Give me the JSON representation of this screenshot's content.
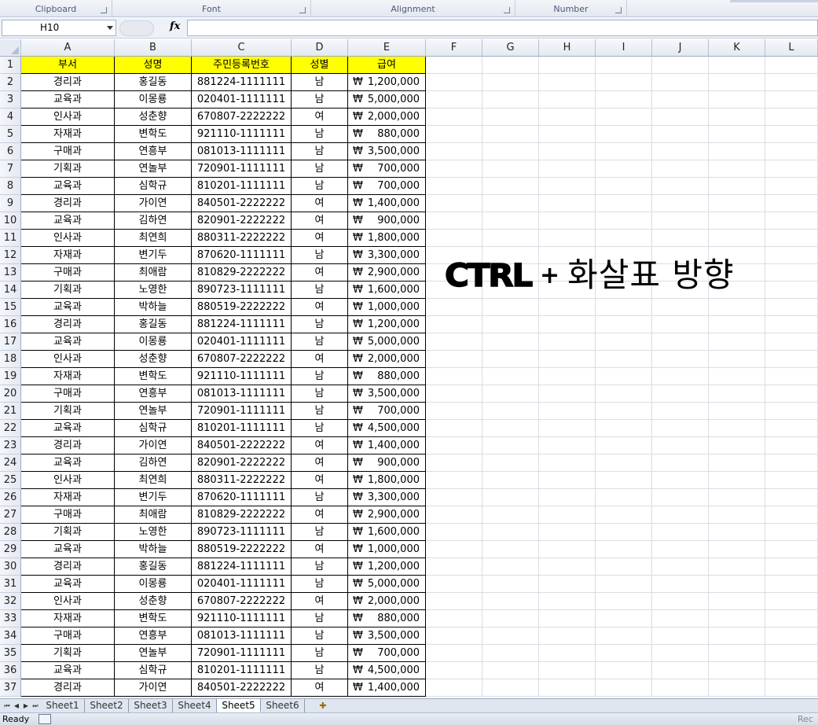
{
  "ribbon": {
    "groups": [
      {
        "label": "Clipboard"
      },
      {
        "label": "Font"
      },
      {
        "label": "Alignment"
      },
      {
        "label": "Number"
      }
    ]
  },
  "formula_bar": {
    "name_box": "H10",
    "fx_label": "fx",
    "formula": ""
  },
  "columns": [
    "A",
    "B",
    "C",
    "D",
    "E",
    "F",
    "G",
    "H",
    "I",
    "J",
    "K",
    "L"
  ],
  "table": {
    "headers": [
      "부서",
      "성명",
      "주민등록번호",
      "성별",
      "급여"
    ],
    "currency_symbol": "₩",
    "rows": [
      [
        "경리과",
        "홍길동",
        "881224-1111111",
        "남",
        "1,200,000"
      ],
      [
        "교육과",
        "이몽룡",
        "020401-1111111",
        "남",
        "5,000,000"
      ],
      [
        "인사과",
        "성춘향",
        "670807-2222222",
        "여",
        "2,000,000"
      ],
      [
        "자재과",
        "변학도",
        "921110-1111111",
        "남",
        "880,000"
      ],
      [
        "구매과",
        "연흥부",
        "081013-1111111",
        "남",
        "3,500,000"
      ],
      [
        "기획과",
        "연놀부",
        "720901-1111111",
        "남",
        "700,000"
      ],
      [
        "교육과",
        "심학규",
        "810201-1111111",
        "남",
        "700,000"
      ],
      [
        "경리과",
        "가이연",
        "840501-2222222",
        "여",
        "1,400,000"
      ],
      [
        "교육과",
        "김하연",
        "820901-2222222",
        "여",
        "900,000"
      ],
      [
        "인사과",
        "최연희",
        "880311-2222222",
        "여",
        "1,800,000"
      ],
      [
        "자재과",
        "변기두",
        "870620-1111111",
        "남",
        "3,300,000"
      ],
      [
        "구매과",
        "최애람",
        "810829-2222222",
        "여",
        "2,900,000"
      ],
      [
        "기획과",
        "노영한",
        "890723-1111111",
        "남",
        "1,600,000"
      ],
      [
        "교육과",
        "박하늘",
        "880519-2222222",
        "여",
        "1,000,000"
      ],
      [
        "경리과",
        "홍길동",
        "881224-1111111",
        "남",
        "1,200,000"
      ],
      [
        "교육과",
        "이몽룡",
        "020401-1111111",
        "남",
        "5,000,000"
      ],
      [
        "인사과",
        "성춘향",
        "670807-2222222",
        "여",
        "2,000,000"
      ],
      [
        "자재과",
        "변학도",
        "921110-1111111",
        "남",
        "880,000"
      ],
      [
        "구매과",
        "연흥부",
        "081013-1111111",
        "남",
        "3,500,000"
      ],
      [
        "기획과",
        "연놀부",
        "720901-1111111",
        "남",
        "700,000"
      ],
      [
        "교육과",
        "심학규",
        "810201-1111111",
        "남",
        "4,500,000"
      ],
      [
        "경리과",
        "가이연",
        "840501-2222222",
        "여",
        "1,400,000"
      ],
      [
        "교육과",
        "김하연",
        "820901-2222222",
        "여",
        "900,000"
      ],
      [
        "인사과",
        "최연희",
        "880311-2222222",
        "여",
        "1,800,000"
      ],
      [
        "자재과",
        "변기두",
        "870620-1111111",
        "남",
        "3,300,000"
      ],
      [
        "구매과",
        "최애람",
        "810829-2222222",
        "여",
        "2,900,000"
      ],
      [
        "기획과",
        "노영한",
        "890723-1111111",
        "남",
        "1,600,000"
      ],
      [
        "교육과",
        "박하늘",
        "880519-2222222",
        "여",
        "1,000,000"
      ],
      [
        "경리과",
        "홍길동",
        "881224-1111111",
        "남",
        "1,200,000"
      ],
      [
        "교육과",
        "이몽룡",
        "020401-1111111",
        "남",
        "5,000,000"
      ],
      [
        "인사과",
        "성춘향",
        "670807-2222222",
        "여",
        "2,000,000"
      ],
      [
        "자재과",
        "변학도",
        "921110-1111111",
        "남",
        "880,000"
      ],
      [
        "구매과",
        "연흥부",
        "081013-1111111",
        "남",
        "3,500,000"
      ],
      [
        "기획과",
        "연놀부",
        "720901-1111111",
        "남",
        "700,000"
      ],
      [
        "교육과",
        "심학규",
        "810201-1111111",
        "남",
        "4,500,000"
      ],
      [
        "경리과",
        "가이연",
        "840501-2222222",
        "여",
        "1,400,000"
      ]
    ]
  },
  "overlay": {
    "key": "CTRL",
    "plus": "+",
    "text": "화살표 방향"
  },
  "sheet_tabs": [
    "Sheet1",
    "Sheet2",
    "Sheet3",
    "Sheet4",
    "Sheet5",
    "Sheet6"
  ],
  "active_sheet": "Sheet5",
  "status": {
    "ready": "Ready",
    "rec": "Rec"
  },
  "colors": {
    "header_fill": "#ffff00"
  }
}
